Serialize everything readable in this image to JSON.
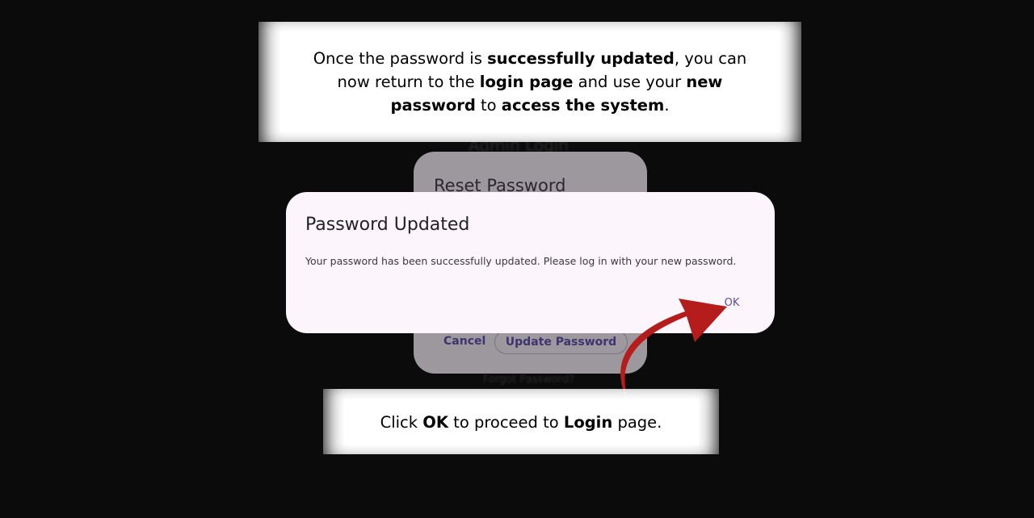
{
  "top_caption": {
    "part1": "Once the password is ",
    "bold1": "successfully updated",
    "part2": ", you can now return to the ",
    "bold2": "login page",
    "part3": " and use your ",
    "bold3": "new password",
    "part4": " to ",
    "bold4": "access the system",
    "part5": "."
  },
  "background": {
    "screen_title": "Admin Login",
    "reset_title": "Reset Password",
    "cancel_label": "Cancel",
    "update_label": "Update Password",
    "forgot_label": "Forgot Password?"
  },
  "dialog": {
    "title": "Password Updated",
    "message": "Your password has been successfully updated. Please log in with your new password.",
    "ok_label": "OK"
  },
  "bottom_caption": {
    "part1": "Click ",
    "bold1": "OK",
    "part2": " to proceed to ",
    "bold2": "Login",
    "part3": " page."
  },
  "colors": {
    "accent": "#5b4e9a",
    "arrow": "#b51c1c",
    "dialog_bg": "#fcf5fc"
  },
  "icons": {
    "arrow": "curved-arrow-icon"
  }
}
